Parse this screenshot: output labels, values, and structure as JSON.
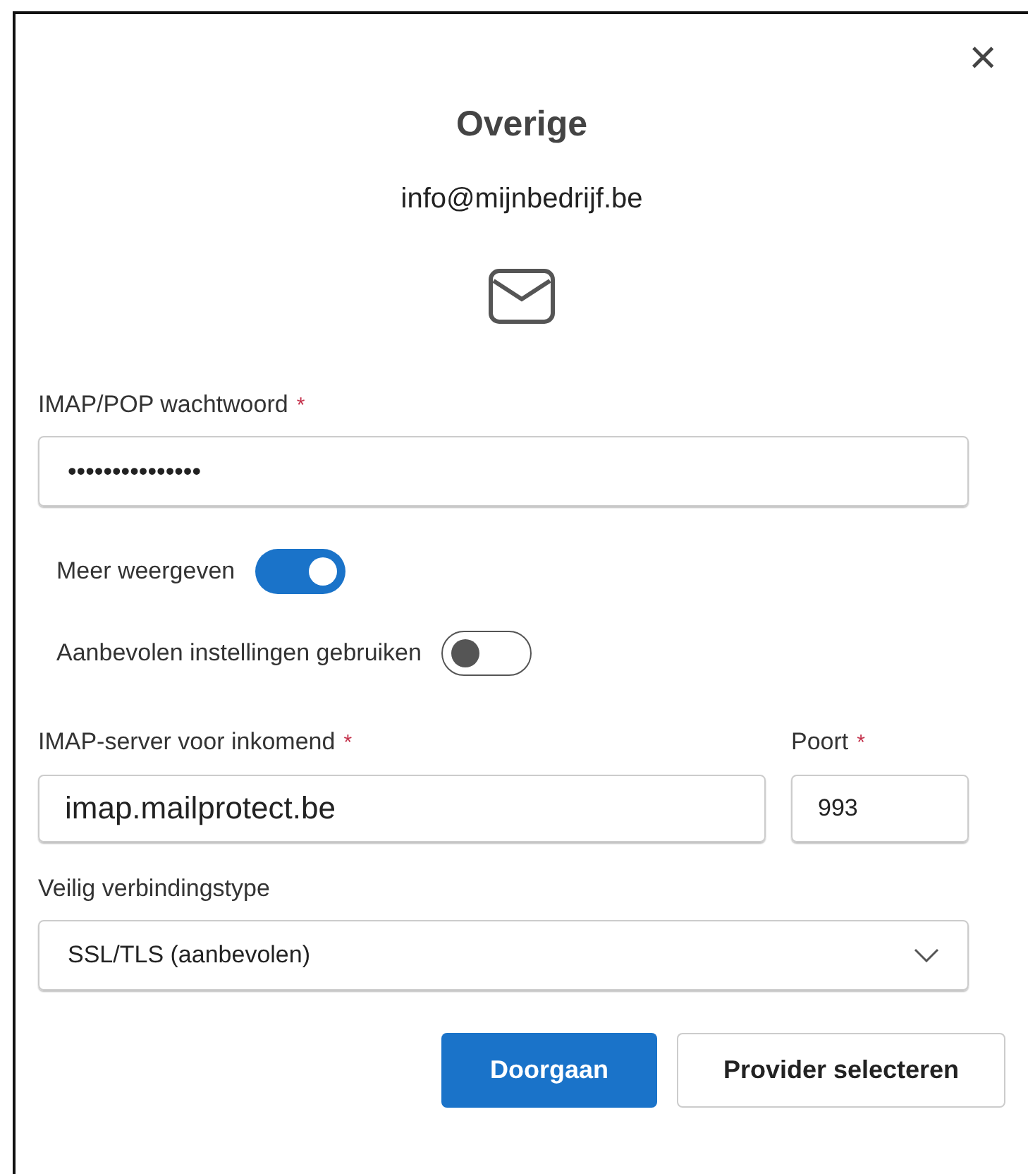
{
  "dialog": {
    "close": "×",
    "title": "Overige",
    "email": "info@mijnbedrijf.be"
  },
  "password": {
    "label": "IMAP/POP wachtwoord",
    "required_mark": "*",
    "value": "•••••••••••••••"
  },
  "toggles": [
    {
      "label": "Meer weergeven",
      "on": true
    },
    {
      "label": "Aanbevolen instellingen gebruiken",
      "on": false
    }
  ],
  "server": {
    "label": "IMAP-server voor inkomend",
    "required_mark": "*",
    "value": "imap.mailprotect.be"
  },
  "port": {
    "label": "Poort",
    "required_mark": "*",
    "value": "993"
  },
  "security": {
    "label": "Veilig verbindingstype",
    "value": "SSL/TLS (aanbevolen)"
  },
  "buttons": [
    {
      "label": "Doorgaan",
      "kind": "primary"
    },
    {
      "label": "Provider selecteren",
      "kind": "secondary"
    }
  ]
}
